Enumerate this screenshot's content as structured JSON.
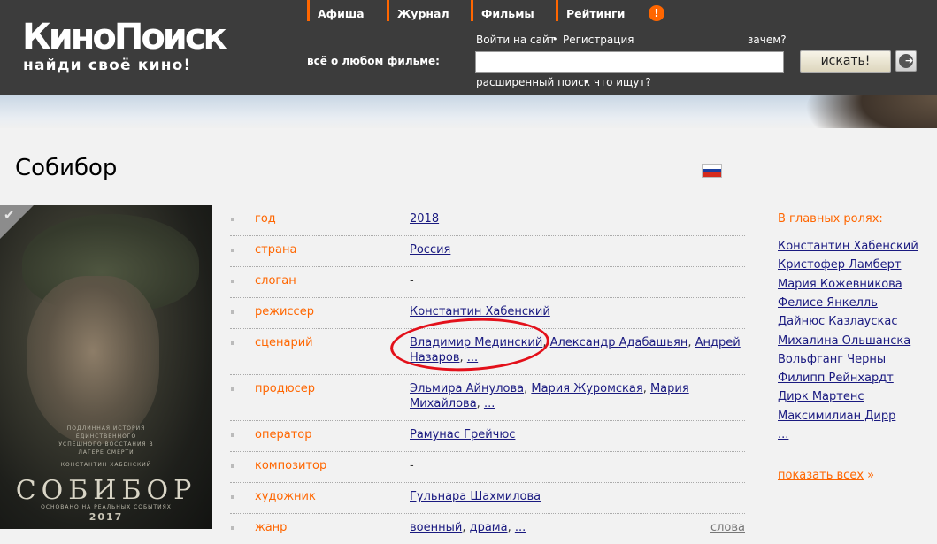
{
  "header": {
    "logo": {
      "main": "КиноПоиск",
      "tagline": "найди своё кино!"
    },
    "nav": [
      {
        "label": "Афиша"
      },
      {
        "label": "Журнал"
      },
      {
        "label": "Фильмы"
      },
      {
        "label": "Рейтинги"
      }
    ],
    "alert_label": "!",
    "login_label": "Войти на сайт",
    "register_label": "Регистрация",
    "why_label": "зачем?",
    "search_label": "всё о любом фильме:",
    "search_value": "",
    "search_button": "искать!",
    "advanced_search": "расширенный поиск",
    "popular_searches": "что ищут?"
  },
  "film": {
    "title": "Собибор",
    "flag_colors": [
      "#ffffff",
      "#1c3f9e",
      "#d52b1e"
    ],
    "poster": {
      "tagline": "ПОДЛИННАЯ ИСТОРИЯ ЕДИНСТВЕННОГО УСПЕШНОГО ВОССТАНИЯ В ЛАГЕРЕ СМЕРТИ",
      "director_credit": "КОНСТАНТИН ХАБЕНСКИЙ",
      "name": "СОБИБОР",
      "subtitle": "ОСНОВАНО НА РЕАЛЬНЫХ СОБЫТИЯХ",
      "year": "2017"
    },
    "info": [
      {
        "key": "год",
        "values": [
          "2018"
        ]
      },
      {
        "key": "страна",
        "values": [
          "Россия"
        ]
      },
      {
        "key": "слоган",
        "plain": "-"
      },
      {
        "key": "режиссер",
        "values": [
          "Константин Хабенский"
        ]
      },
      {
        "key": "сценарий",
        "values": [
          "Владимир Мединский",
          "Александр Адабашьян",
          "Андрей Назаров",
          "..."
        ]
      },
      {
        "key": "продюсер",
        "values": [
          "Эльмира Айнулова",
          "Мария Журомская",
          "Мария Михайлова",
          "..."
        ]
      },
      {
        "key": "оператор",
        "values": [
          "Рамунас Грейчюс"
        ]
      },
      {
        "key": "композитор",
        "plain": "-"
      },
      {
        "key": "художник",
        "values": [
          "Гульнара Шахмилова"
        ]
      },
      {
        "key": "жанр",
        "values": [
          "военный",
          "драма",
          "..."
        ],
        "extra": "слова"
      }
    ]
  },
  "cast": {
    "heading": "В главных ролях:",
    "actors": [
      "Константин Хабенский",
      "Кристофер Ламберт",
      "Мария Кожевникова",
      "Фелисе Янкелль",
      "Дайнюс Казлаускас",
      "Михалина Ольшанска",
      "Вольфганг Черны",
      "Филипп Рейнхардт",
      "Дирк Мартенс",
      "Максимилиан Дирр",
      "..."
    ],
    "show_all": "показать всех",
    "show_all_arrow": "»"
  },
  "colors": {
    "accent": "#ff6600",
    "header_bg": "#3c3c3c",
    "link": "#1a1a80",
    "annotation": "#e3101a"
  }
}
